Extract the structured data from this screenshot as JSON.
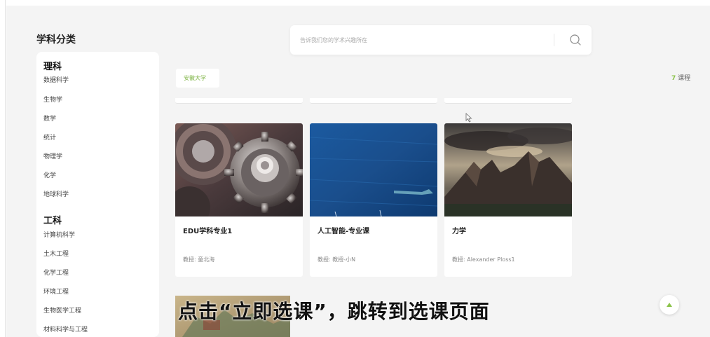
{
  "sidebar": {
    "title": "学科分类",
    "groups": [
      {
        "title": "理科",
        "items": [
          "数据科学",
          "生物学",
          "数学",
          "统计",
          "物理学",
          "化学",
          "地球科学"
        ]
      },
      {
        "title": "工科",
        "items": [
          "计算机科学",
          "土木工程",
          "化学工程",
          "环境工程",
          "生物医学工程",
          "材料科学与工程"
        ]
      }
    ]
  },
  "search": {
    "placeholder": "告诉我们您的学术兴趣所在",
    "icon": "search-icon"
  },
  "filter": {
    "tag_label": "安徽大学",
    "count": "7",
    "count_unit": "课程"
  },
  "courses": [
    {
      "title": "EDU学科专业1",
      "teacher": "教授: 童北海",
      "image": "gears-image"
    },
    {
      "title": "人工智能-专业课",
      "teacher": "教授: 教授-小N",
      "image": "ocean-image"
    },
    {
      "title": "力学",
      "teacher": "教授: Alexander Ploss1",
      "image": "mountains-image"
    }
  ],
  "subtitle": "点击“立即选课”，跳转到选课页面",
  "colors": {
    "accent": "#8bc34a",
    "background": "#f4f4f4"
  }
}
